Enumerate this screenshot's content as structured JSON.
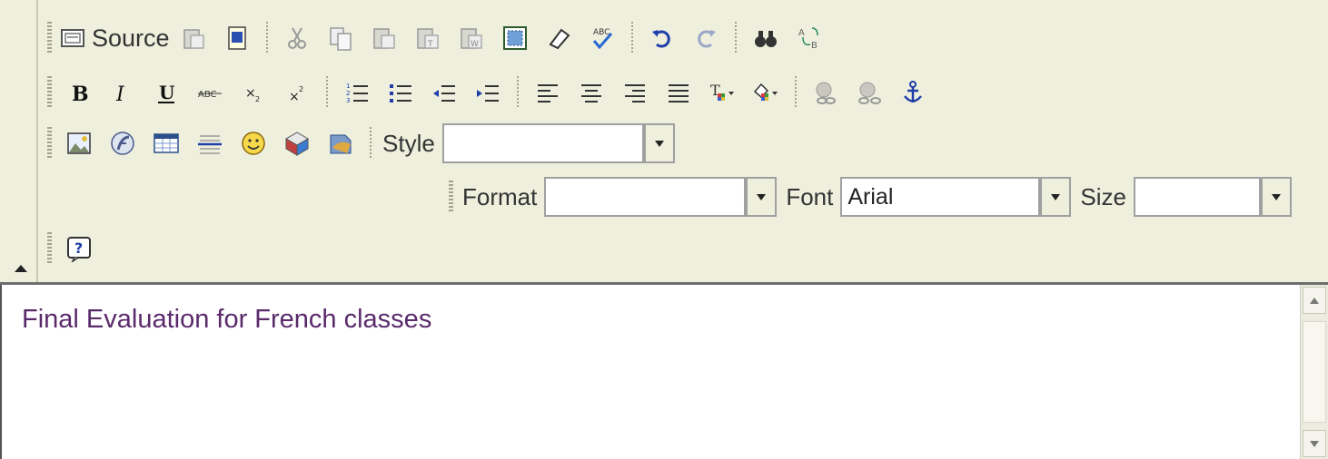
{
  "toolbar": {
    "source_label": "Source",
    "style_label": "Style",
    "style_value": "",
    "format_label": "Format",
    "format_value": "",
    "font_label": "Font",
    "font_value": "Arial",
    "size_label": "Size",
    "size_value": ""
  },
  "editor": {
    "text": "Final Evaluation for French classes"
  },
  "colors": {
    "toolbar_bg": "#efefde",
    "text_color": "#5a2a6b"
  },
  "icons": [
    "source-icon",
    "paste-icon",
    "paste-word-icon",
    "cut-icon",
    "copy-icon",
    "paste-text-icon",
    "paste-plain-icon",
    "paste-from-word-icon",
    "select-all-icon",
    "remove-format-icon",
    "spellcheck-icon",
    "undo-icon",
    "redo-icon",
    "find-icon",
    "replace-icon",
    "bold-icon",
    "italic-icon",
    "underline-icon",
    "strikethrough-icon",
    "subscript-icon",
    "superscript-icon",
    "ordered-list-icon",
    "unordered-list-icon",
    "outdent-icon",
    "indent-icon",
    "align-left-icon",
    "align-center-icon",
    "align-right-icon",
    "justify-icon",
    "text-color-icon",
    "background-color-icon",
    "link-icon",
    "unlink-icon",
    "anchor-icon",
    "image-icon",
    "flash-icon",
    "table-icon",
    "horizontal-rule-icon",
    "smiley-icon",
    "special-char-icon",
    "page-break-icon",
    "help-icon"
  ]
}
